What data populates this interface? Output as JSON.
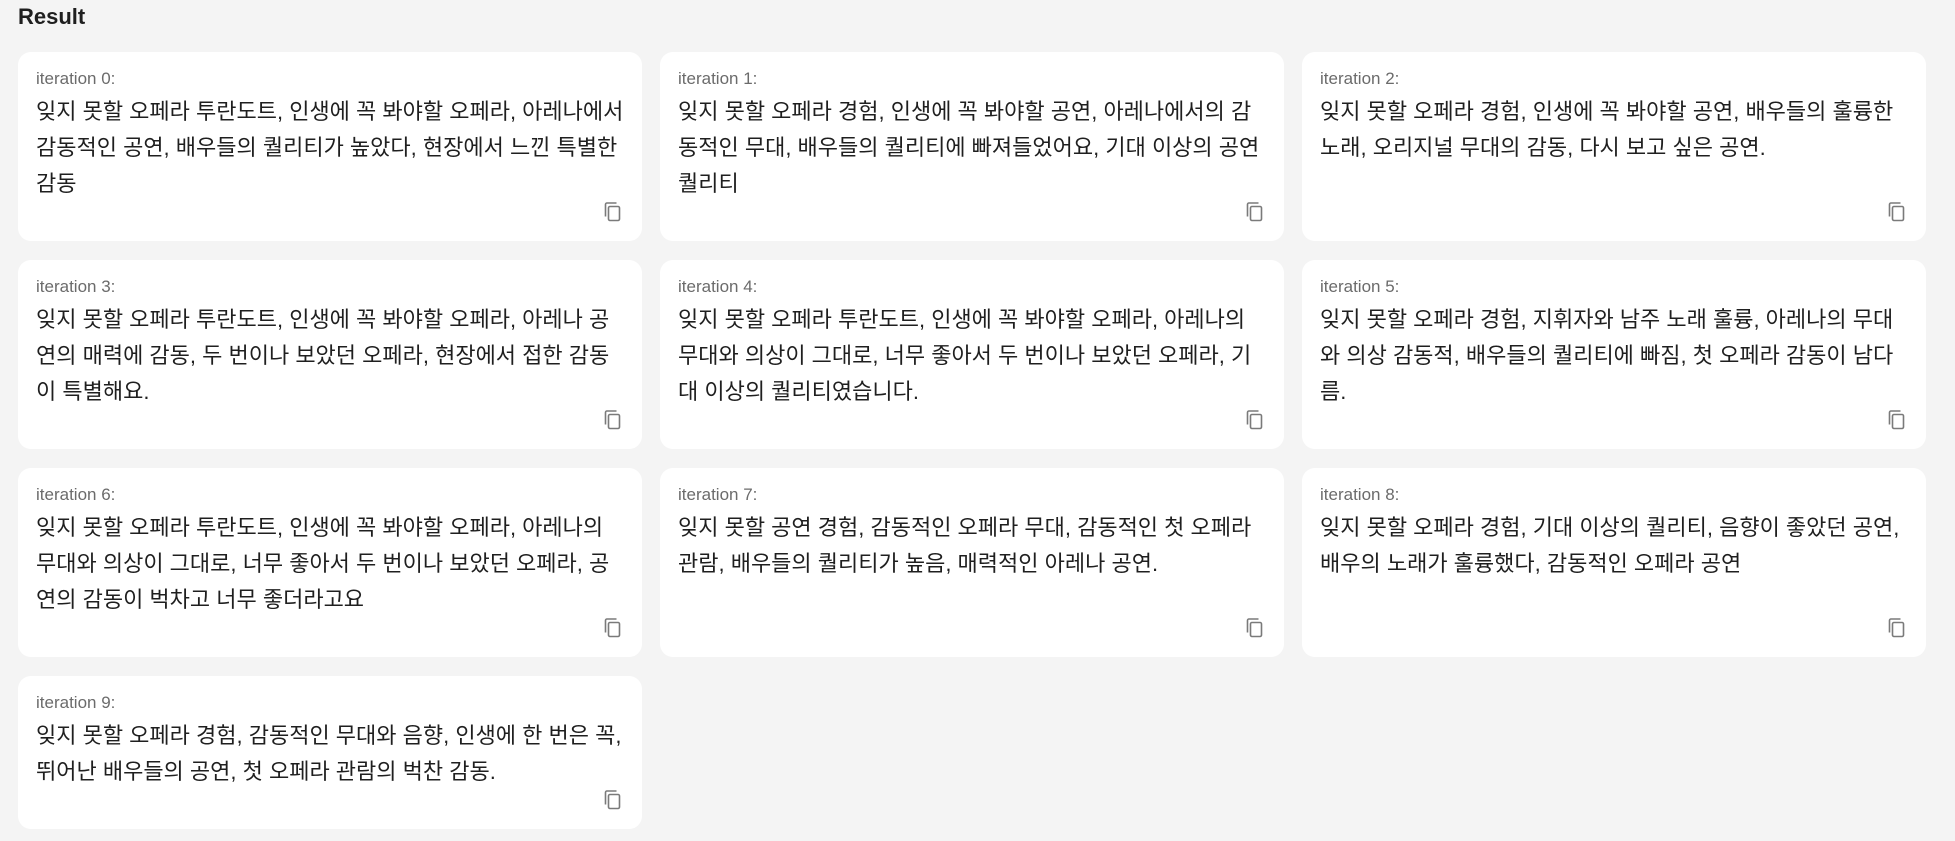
{
  "header": {
    "title": "Result"
  },
  "copy_icon": "copy-icon",
  "results": [
    {
      "label": "iteration 0:",
      "text": "잊지 못할 오페라 투란도트, 인생에 꼭 봐야할 오페라, 아레나에서 감동적인 공연, 배우들의 퀄리티가 높았다, 현장에서 느낀 특별한 감동"
    },
    {
      "label": "iteration 1:",
      "text": "잊지 못할 오페라 경험, 인생에 꼭 봐야할 공연, 아레나에서의 감동적인 무대, 배우들의 퀄리티에 빠져들었어요, 기대 이상의 공연 퀄리티"
    },
    {
      "label": "iteration 2:",
      "text": "잊지 못할 오페라 경험, 인생에 꼭 봐야할 공연, 배우들의 훌륭한 노래, 오리지널 무대의 감동, 다시 보고 싶은 공연."
    },
    {
      "label": "iteration 3:",
      "text": "잊지 못할 오페라 투란도트, 인생에 꼭 봐야할 오페라, 아레나 공연의 매력에 감동, 두 번이나 보았던 오페라, 현장에서 접한 감동이 특별해요."
    },
    {
      "label": "iteration 4:",
      "text": "잊지 못할 오페라 투란도트, 인생에 꼭 봐야할 오페라, 아레나의 무대와 의상이 그대로, 너무 좋아서 두 번이나 보았던 오페라, 기대 이상의 퀄리티였습니다."
    },
    {
      "label": "iteration 5:",
      "text": "잊지 못할 오페라 경험, 지휘자와 남주 노래 훌륭, 아레나의 무대와 의상 감동적, 배우들의 퀄리티에 빠짐, 첫 오페라 감동이 남다름."
    },
    {
      "label": "iteration 6:",
      "text": "잊지 못할 오페라 투란도트, 인생에 꼭 봐야할 오페라, 아레나의 무대와 의상이 그대로, 너무 좋아서 두 번이나 보았던 오페라, 공연의 감동이 벅차고 너무 좋더라고요"
    },
    {
      "label": "iteration 7:",
      "text": "잊지 못할 공연 경험, 감동적인 오페라 무대, 감동적인 첫 오페라 관람, 배우들의 퀄리티가 높음, 매력적인 아레나 공연."
    },
    {
      "label": "iteration 8:",
      "text": "잊지 못할 오페라 경험, 기대 이상의 퀄리티, 음향이 좋았던 공연, 배우의 노래가 훌륭했다, 감동적인 오페라 공연"
    },
    {
      "label": "iteration 9:",
      "text": "잊지 못할 오페라 경험, 감동적인 무대와 음향, 인생에 한 번은 꼭, 뛰어난 배우들의 공연, 첫 오페라 관람의 벅찬 감동."
    }
  ]
}
